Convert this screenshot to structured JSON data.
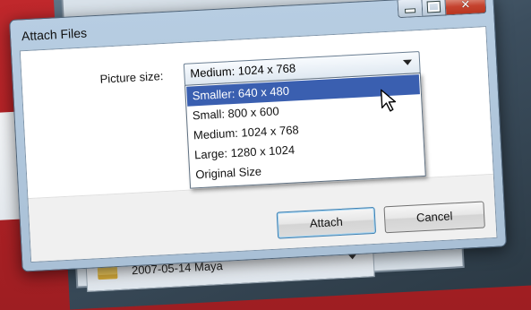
{
  "background": {
    "folder_label": "2007-05-14 Maya"
  },
  "dialog": {
    "title": "Attach Files",
    "caption_buttons": {
      "minimize": "—",
      "maximize": "□",
      "close": "✕"
    },
    "picture_size_label": "Picture size:",
    "picture_size_value": "Medium: 1024 x 768",
    "options": [
      "Smaller: 640 x 480",
      "Small: 800 x 600",
      "Medium: 1024 x 768",
      "Large: 1280 x 1024",
      "Original Size"
    ],
    "highlighted_option": "Smaller: 640 x 480",
    "attach_label": "Attach",
    "cancel_label": "Cancel"
  },
  "icons": {
    "cursor": "arrow-cursor-icon",
    "dropdown": "chevron-down-icon",
    "folder": "folder-icon"
  },
  "colors": {
    "selection": "#3a5fb0",
    "default_button_border": "#3c7fb1",
    "close_button": "#c5432f",
    "titlebar": "#b7cde2"
  }
}
